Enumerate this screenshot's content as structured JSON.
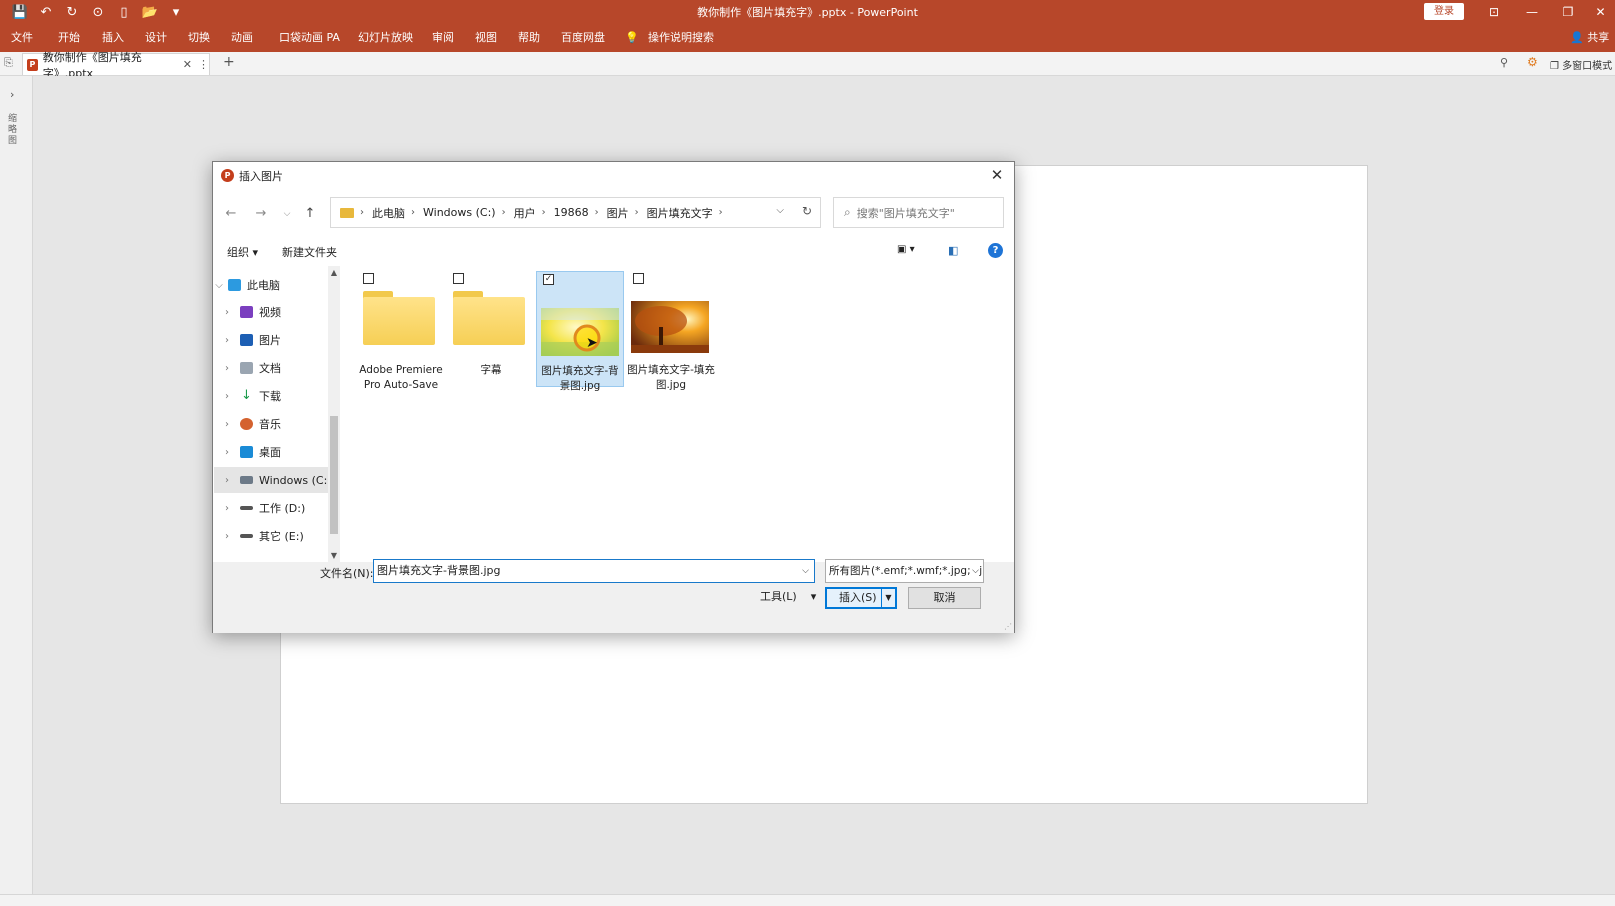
{
  "window": {
    "title": "教你制作《图片填充字》.pptx  -  PowerPoint",
    "login_label": "登录",
    "share_label": "共享",
    "accent_color": "#b7472a"
  },
  "menu": [
    "文件",
    "开始",
    "插入",
    "设计",
    "切换",
    "动画",
    "口袋动画 PA",
    "幻灯片放映",
    "审阅",
    "视图",
    "帮助",
    "百度网盘",
    "操作说明搜索"
  ],
  "tab": {
    "name": "教你制作《图片填充字》.pptx",
    "multi_window_label": "多窗口模式"
  },
  "left_panel": {
    "vertical_label": "缩略图"
  },
  "dialog": {
    "title": "插入图片",
    "breadcrumb": [
      "此电脑",
      "Windows (C:)",
      "用户",
      "19868",
      "图片",
      "图片填充文字"
    ],
    "search_placeholder": "搜索\"图片填充文字\"",
    "organize_label": "组织 ▾",
    "new_folder_label": "新建文件夹",
    "tree": [
      {
        "label": "此电脑",
        "icon": "computer-icon",
        "expanded": true
      },
      {
        "label": "视频",
        "icon": "video-icon"
      },
      {
        "label": "图片",
        "icon": "pictures-icon"
      },
      {
        "label": "文档",
        "icon": "documents-icon"
      },
      {
        "label": "下载",
        "icon": "download-icon"
      },
      {
        "label": "音乐",
        "icon": "music-icon"
      },
      {
        "label": "桌面",
        "icon": "desktop-icon"
      },
      {
        "label": "Windows (C:)",
        "icon": "drive-icon",
        "selected": true
      },
      {
        "label": "工作 (D:)",
        "icon": "drive-icon"
      },
      {
        "label": "其它 (E:)",
        "icon": "drive-icon"
      }
    ],
    "files": [
      {
        "name": "Adobe Premiere Pro Auto-Save",
        "type": "folder",
        "checked": false
      },
      {
        "name": "字幕",
        "type": "folder",
        "checked": false
      },
      {
        "name": "图片填充文字-背景图.jpg",
        "type": "image",
        "checked": true
      },
      {
        "name": "图片填充文字-填充图.jpg",
        "type": "image",
        "checked": false
      }
    ],
    "filename_label": "文件名(N):",
    "filename_value": "图片填充文字-背景图.jpg",
    "filter_value": "所有图片(*.emf;*.wmf;*.jpg;*.jpeg",
    "tools_label": "工具(L)",
    "insert_label": "插入(S)",
    "cancel_label": "取消"
  }
}
